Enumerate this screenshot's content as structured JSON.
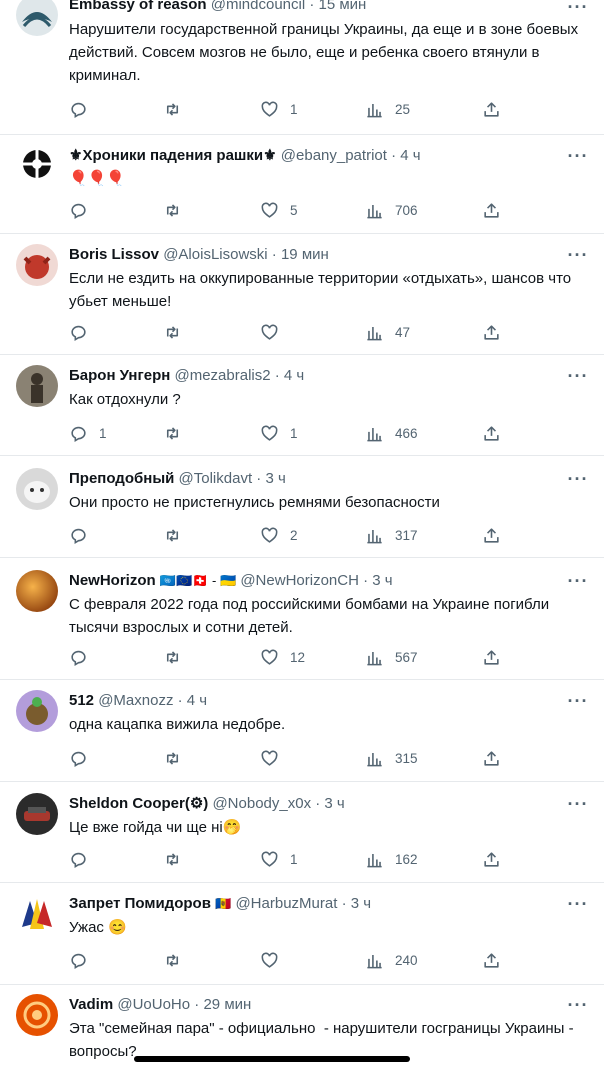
{
  "tweets": [
    {
      "name": "Embassy of reason",
      "handle": "@mindcouncil",
      "time": "15 мин",
      "text": "Нарушители государственной границы Украины, да еще и в зоне боевых действий. Совсем мозгов не было, еще и ребенка своего втянули в криминал.",
      "reply_count": "",
      "retweet_count": "",
      "like_count": "1",
      "view_count": "25",
      "avatar_color": "#2e5a6b"
    },
    {
      "name": "⚜Хроники падения рашки⚜",
      "handle": "@ebany_patriot",
      "time": "4 ч",
      "text": "🎈🎈🎈",
      "reply_count": "",
      "retweet_count": "",
      "like_count": "5",
      "view_count": "706",
      "avatar_color": "#111111"
    },
    {
      "name": "Boris Lissov",
      "handle": "@AloisLisowski",
      "time": "19 мин",
      "text": "Если не ездить на оккупированные территории «отдыхать», шансов что убьет меньше!",
      "reply_count": "",
      "retweet_count": "",
      "like_count": "",
      "view_count": "47",
      "avatar_color": "#c0392b"
    },
    {
      "name": "Барон Унгерн",
      "handle": "@mezabralis2",
      "time": "4 ч",
      "text": "Как отдохнули ?",
      "reply_count": "1",
      "retweet_count": "",
      "like_count": "1",
      "view_count": "466",
      "avatar_color": "#5b5446"
    },
    {
      "name": "Преподобный",
      "handle": "@Tolikdavt",
      "time": "3 ч",
      "text": "Они просто не пристегнулись ремнями безопасности",
      "reply_count": "",
      "retweet_count": "",
      "like_count": "2",
      "view_count": "317",
      "avatar_color": "#b9b9b9"
    },
    {
      "name": "NewHorizon",
      "flags": "🇺🇳🇪🇺🇨🇭 - 🇺🇦",
      "handle": "@NewHorizonCH",
      "time": "3 ч",
      "text": "С февраля 2022 года под российскими бомбами на Украине погибли тысячи взрослых и сотни детей.",
      "reply_count": "",
      "retweet_count": "",
      "like_count": "12",
      "view_count": "567",
      "avatar_color": "#d2691e"
    },
    {
      "name": "512",
      "handle": "@Maxnozz",
      "time": "4 ч",
      "text": "одна кацапка вижила недобре.",
      "reply_count": "",
      "retweet_count": "",
      "like_count": "",
      "view_count": "315",
      "avatar_color": "#b39ddb"
    },
    {
      "name": "Sheldon Cooper(⚙)",
      "handle": "@Nobody_x0x",
      "time": "3 ч",
      "text": "Це вже гойда чи ще ні🤭",
      "reply_count": "",
      "retweet_count": "",
      "like_count": "1",
      "view_count": "162",
      "avatar_color": "#3a2a2a"
    },
    {
      "name": "Запрет Помидоров",
      "flags": "🇲🇩",
      "handle": "@HarbuzMurat",
      "time": "3 ч",
      "text": "Ужас 😊",
      "reply_count": "",
      "retweet_count": "",
      "like_count": "",
      "view_count": "240",
      "avatar_color": "#1e3a8a"
    },
    {
      "name": "Vadim",
      "handle": "@UoUoHo",
      "time": "29 мин",
      "text": "Эта \"семейная пара\" - официально  - нарушители госграницы Украины - вопросы?",
      "reply_count": "",
      "retweet_count": "",
      "like_count": "",
      "view_count": "",
      "avatar_color": "#e65100"
    }
  ],
  "dot_separator": "·",
  "more_label": "···",
  "colors": {
    "text_primary": "#0f1419",
    "text_secondary": "#536471",
    "divider": "#e6e9ec"
  },
  "icons": [
    "reply-icon",
    "retweet-icon",
    "like-icon",
    "views-icon",
    "share-icon",
    "more-icon"
  ]
}
